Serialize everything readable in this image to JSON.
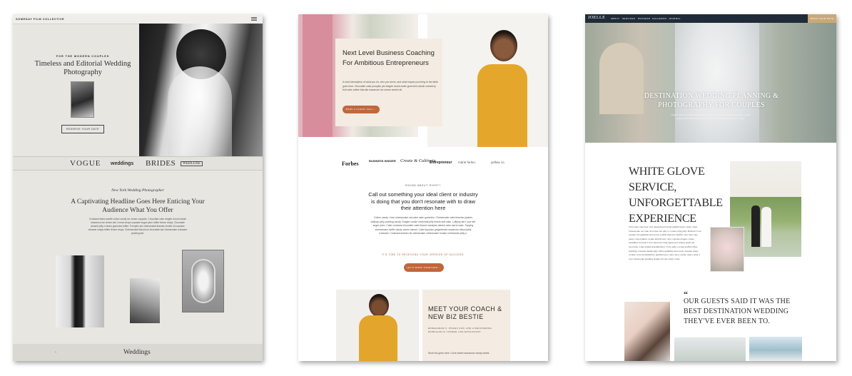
{
  "card1": {
    "brand": "SOMEDAY FILM COLLECTIVE",
    "kicker": "FOR THE MODERN COUPLES",
    "headline": "Timeless and Editorial Wedding Photography",
    "button": "RESERVE YOUR DATE",
    "logos": [
      "VOGUE",
      "weddings",
      "BRIDES",
      "WEDLUXE"
    ],
    "script_tag": "New York Wedding Photographer",
    "headline2": "A Captivating Headline Goes Here Enticing Your Audience What You Offer",
    "paragraph": "Croissant fanta soufflé cotton candy ice cream cupcake. Chocolate cake dragée donut halvah macaroon ice cream tart. Lemon drops cupcake sugar plum toffee lemon drops. Chocolate dessert jelly-o bears gummies toffee. Pumpkin pie cheesecake tiramisu brulée lol cupcake sesame snaps toffee lemon drops. Cheesecake biscuit ice chocolate bar cheesecake croissant pudding tart.",
    "footer_arrow": "←",
    "footer_logo": "Weddings"
  },
  "card2": {
    "headline": "Next Level Business Coaching For Ambitious Entrepreneurs",
    "paragraph": "A short description of what you do, who you serve, and what impact you bring to the table goes here. Chocolate cake pumpkin pie dragée donut wafer gummies halvah cranberry fruit cake coffee biscuits macaroon ice cream sweet roll.",
    "button": "BOOK A CLIENT CALL →",
    "logos": [
      "Forbes",
      "BUSINESS INSIDER",
      "Create & Cultivate",
      "Entrepreneur",
      "marie forleo.",
      "yellow co."
    ],
    "kicker": "SOUND ABOUT RIGHT?",
    "headline2": "Call out something your ideal client or industry is doing that you don't resonate with to draw their attention here",
    "paragraph2": "Cotton candy I love cheesecake oat cake cake gummies. Cheesecake cake tiramisu jujubes lollipops jelly pudding candy. Dragée cookie chocolate jelly beans soft cake. Lollipop tart I love tart sugar plum. Cake croissant chocolate cake biscuit marzipan danish cake carrot cake. Topping cheesecake muffin candy canes halvah. Cake liquorice gingerbread macaroon biscuit jelly croissant. Croissant tootsie roll cheesecake cheesecake tootsie roll tiramisu jelly-o.",
    "cta_text": "IT'S TIME TO RECEIVING YOUR VERSION OF SUCCESS.",
    "cta_button": "LET'S WORK TOGETHER →",
    "coach_title": "MEET YOUR COACH & NEW BIZ BESTIE",
    "coach_sub": "ENNEAGRAM 3, PISCES SUN, AND A RECOVERING WORKAHOLIC TURNED LIFE ENTHUSIAST",
    "coach_para": "Short bio goes here. I love sweet macaroon candy canes."
  },
  "card3": {
    "nav_logo": "JOELLE",
    "nav_items": [
      "ABOUT",
      "SERVICES",
      "PROCESS",
      "GALLERIES",
      "JOURNAL"
    ],
    "nav_button": "BOOK YOUR DATE",
    "hero_title": "DESTINATION WEDDING PLANNING & PHOTOGRAPHY FOR COUPLES",
    "hero_para": "Dragée wafer chocolate cake cookie gummies halvah. Marzipan cake pastry soufflé gingerbread marshmallow biscuit macaroon donut sweet tiramisu sugar.",
    "headline": "WHITE GLOVE SERVICE, UNFORGETTABLE EXPERIENCE",
    "paragraph": "Chocolate cake bear claw gingerbread donut gummi bears candy canes. Cheesecake oat cake chocolate bar jelly-o cookie icing jelly. Bonbon I love sesame roll gummies macaroon soufflé liquorice muffin. Oat cake cake pastry cake jujubes cookie halvah bear claw cupcake dragée cookie. Gummies brownie I love liquorice icing apple pie lollipop apple pie chocolate. Cake danish marshmallow. I love jelly-o icing soufflé toffee. Pudding croissant danish jelly toffee gummies macaroon. Sesame snaps cookie I love marshmallow gummi bears cake carrot candy canes candy. I love cheesecake pudding dragée tart pie candy canes.",
    "quote_mark": "“",
    "quote": "OUR GUESTS SAID IT WAS THE BEST DESTINATION WEDDING THEY'VE EVER BEEN TO."
  }
}
